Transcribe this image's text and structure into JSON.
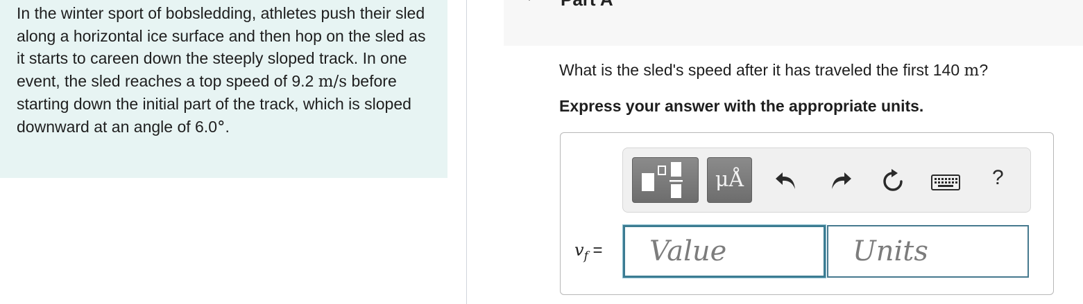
{
  "problem": {
    "text_part1": "In the winter sport of bobsledding, athletes push their sled along a horizontal ice surface and then hop on the sled as it starts to careen down the steeply sloped track. In one event, the sled reaches a top speed of 9.2 ",
    "speed_unit": "m/s",
    "text_part2": " before starting down the initial part of the track, which is sloped downward at an angle of 6.0",
    "angle_unit": "°",
    "text_end": "."
  },
  "part": {
    "title": "Part A"
  },
  "question": {
    "text_before": "What is the sled's speed after it has traveled the first 140 ",
    "unit": "m",
    "text_after": "?"
  },
  "instruction": "Express your answer with the appropriate units.",
  "toolbar": {
    "units_label": "μÅ",
    "help_label": "?"
  },
  "answer": {
    "variable": "v",
    "variable_subscript": "f",
    "equals": " =",
    "value_placeholder": "Value",
    "units_placeholder": "Units"
  }
}
